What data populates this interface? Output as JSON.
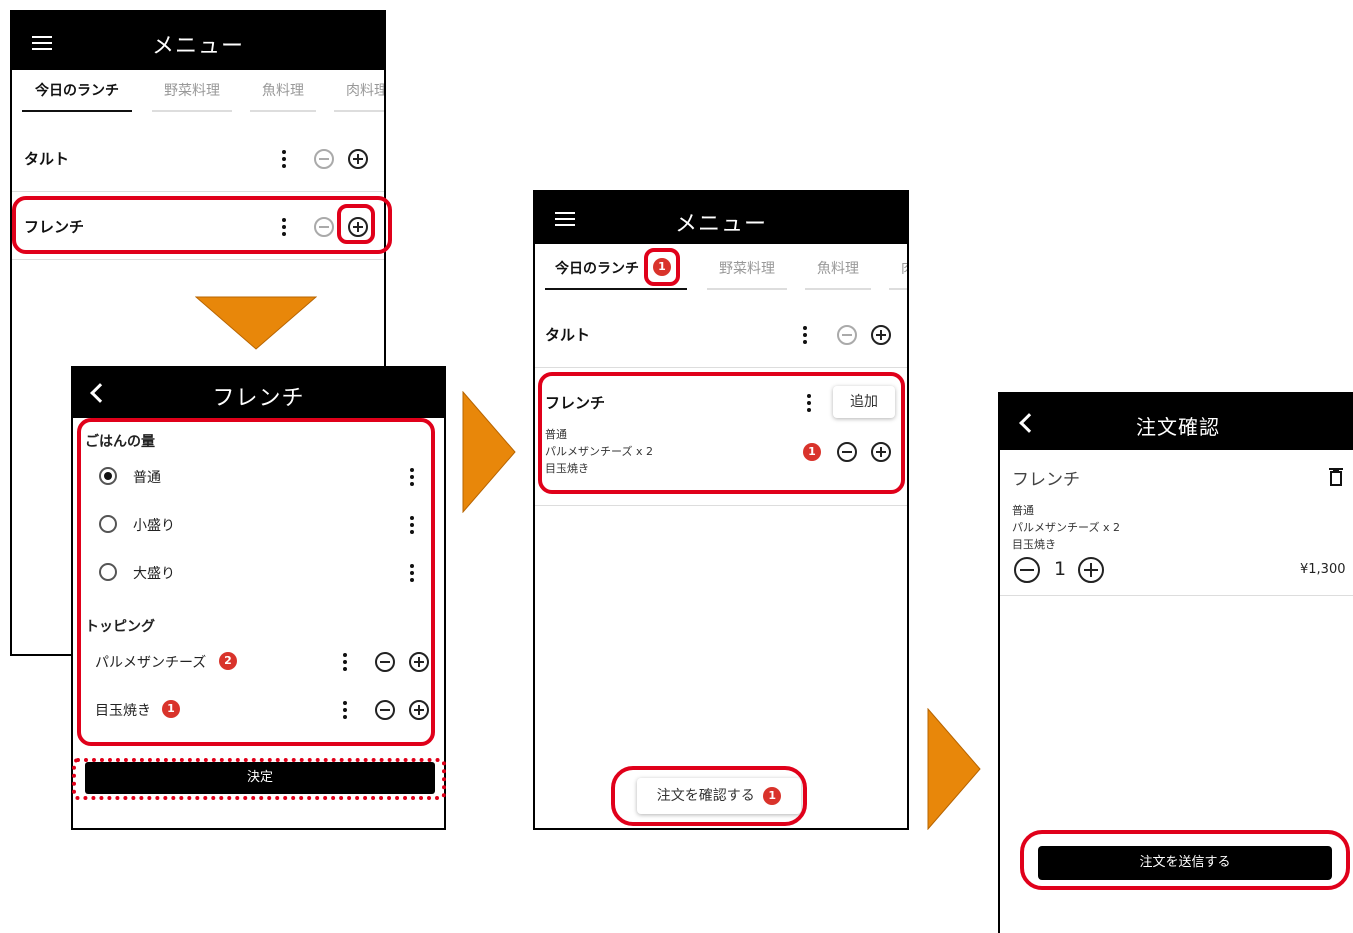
{
  "screen1": {
    "title": "メニュー",
    "tabs": [
      "今日のランチ",
      "野菜料理",
      "魚料理",
      "肉料理"
    ],
    "items": [
      "タルト",
      "フレンチ"
    ]
  },
  "screen2": {
    "title": "フレンチ",
    "rice_heading": "ごはんの量",
    "rice_options": [
      {
        "label": "普通",
        "selected": true
      },
      {
        "label": "小盛り",
        "selected": false
      },
      {
        "label": "大盛り",
        "selected": false
      }
    ],
    "topping_heading": "トッピング",
    "toppings": [
      {
        "label": "パルメザンチーズ",
        "count": "2"
      },
      {
        "label": "目玉焼き",
        "count": "1"
      }
    ],
    "confirm_label": "決定"
  },
  "screen3": {
    "title": "メニュー",
    "tabs": [
      "今日のランチ",
      "野菜料理",
      "魚料理",
      "肉"
    ],
    "tab_badge": "1",
    "items": [
      "タルト",
      "フレンチ"
    ],
    "add_label": "追加",
    "details": [
      "普通",
      "パルメザンチーズ x 2",
      "目玉焼き"
    ],
    "item_badge": "1",
    "confirm_order_label": "注文を確認する",
    "confirm_order_badge": "1"
  },
  "screen4": {
    "title": "注文確認",
    "item_name": "フレンチ",
    "details": [
      "普通",
      "パルメザンチーズ x 2",
      "目玉焼き"
    ],
    "quantity": "1",
    "price": "¥1,300",
    "submit_label": "注文を送信する"
  },
  "colors": {
    "highlight": "#e0001a",
    "arrow": "#e8870a",
    "badge": "#d9332b",
    "appbar": "#000000"
  }
}
